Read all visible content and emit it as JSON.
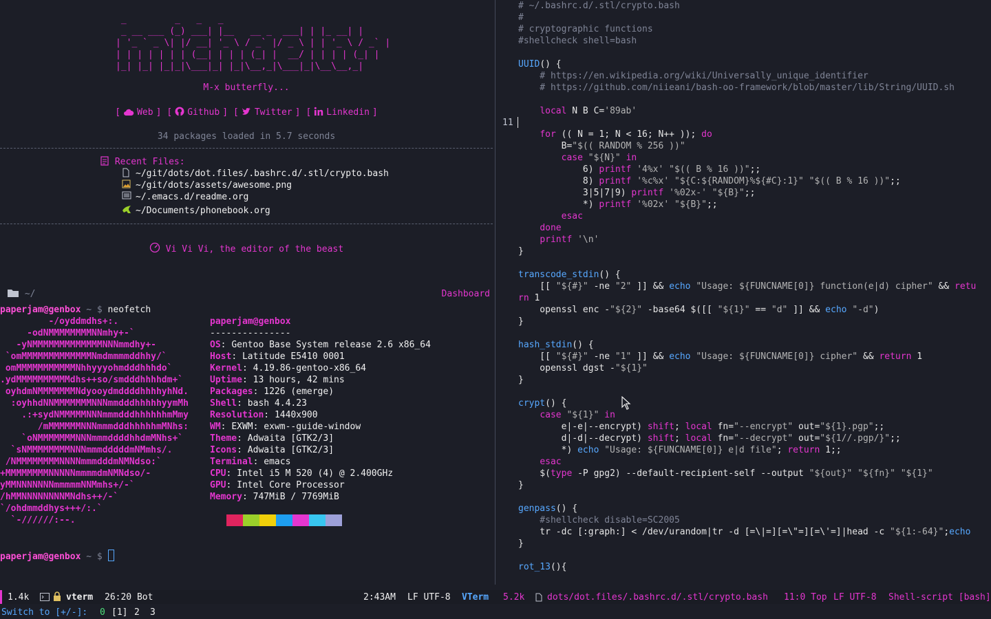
{
  "dashboard": {
    "banner": " _         _   _   _\n _ __ ___ (_) ___| |__   __ _  ___| | |_ __| |\n| '_ ` _ \\| |/ __| '_ \\ / _` |/ _ \\ | | '_ \\ / _` |\n| | | | | | | (__| | | | (_| |  __/ | | | | (_| |\n|_| |_| |_|_|\\___|_| |_|\\__,_|\\___|_|\\__\\__,_|",
    "tagline": "M-x butterfly...",
    "links": [
      {
        "icon": "cloud-icon",
        "label": "Web"
      },
      {
        "icon": "github-icon",
        "label": "Github"
      },
      {
        "icon": "twitter-icon",
        "label": "Twitter"
      },
      {
        "icon": "linkedin-icon",
        "label": "Linkedin"
      }
    ],
    "packages_line": "34 packages loaded in 5.7 seconds",
    "recent_header": "Recent Files:",
    "recent_files": [
      {
        "icon": "file-icon",
        "path": "~/git/dots/dot.files/.bashrc.d/.stl/crypto.bash"
      },
      {
        "icon": "image-icon",
        "path": "~/git/dots/assets/awesome.png"
      },
      {
        "icon": "org-file-icon",
        "path": "~/.emacs.d/readme.org"
      },
      {
        "icon": "org-unicorn-icon",
        "path": "~/Documents/phonebook.org"
      }
    ],
    "footer_text": "Vi Vi Vi, the editor of the beast",
    "folder_path": "~/",
    "buffer_label": "Dashboard"
  },
  "terminal": {
    "prompt1_user": "paperjam@genbox",
    "prompt1_path": "~ $",
    "prompt1_cmd": " neofetch",
    "art_lines": [
      "         -/oyddmdhs+:.",
      "     -odNMMMMMMMMNNmhy+-`",
      "   -yNMMMMMMMMMMMMMNNNmmdhy+-",
      " `omMMMMMMMMMMMMMNmdmmmmddhhy/`",
      " omMMMMMMMMMMMNhhyyyohmdddhhhdo`",
      ".ydMMMMMMMMMMdhs++so/smdddhhhhdm+`",
      " oyhdmNMMMMMMMNdyooydmddddhhhhyhNd.",
      "  :oyhhdNNMMMMMMMNNNmmdddhhhhhyymMh",
      "    .:+sydNMMMMMNNNmmmdddhhhhhhmMmy",
      "       /mMMMMMMNNNmmmdddhhhhhmMNhs:",
      "    `oNMMMMMMMNNNmmmddddhhdmMNhs+`",
      "  `sNMMMMMMMMNNNmmmdddddmNMmhs/.",
      " /NMMMMMMMMNNNNmmmdddmNMNdso:`",
      "+MMMMMMMMNNNNNmmmmdmNMNdso/-",
      "yMMNNNNNNNmmmmmNNMmhs+/-`",
      "/hMMNNNNNNNNMNdhs++/-`",
      "`/ohdmmddhys+++/:.`",
      "  `-//////:--."
    ],
    "info_user": "paperjam@genbox",
    "info_sep": "---------------",
    "info": [
      {
        "k": "OS",
        "v": "Gentoo Base System release 2.6 x86_64"
      },
      {
        "k": "Host",
        "v": "Latitude E5410 0001"
      },
      {
        "k": "Kernel",
        "v": "4.19.86-gentoo-x86_64"
      },
      {
        "k": "Uptime",
        "v": "13 hours, 42 mins"
      },
      {
        "k": "Packages",
        "v": "1226 (emerge)"
      },
      {
        "k": "Shell",
        "v": "bash 4.4.23"
      },
      {
        "k": "Resolution",
        "v": "1440x900"
      },
      {
        "k": "WM",
        "v": "EXWM: exwm--guide-window"
      },
      {
        "k": "Theme",
        "v": "Adwaita [GTK2/3]"
      },
      {
        "k": "Icons",
        "v": "Adwaita [GTK2/3]"
      },
      {
        "k": "Terminal",
        "v": "emacs"
      },
      {
        "k": "CPU",
        "v": "Intel i5 M 520 (4) @ 2.400GHz"
      },
      {
        "k": "GPU",
        "v": "Intel Core Processor"
      },
      {
        "k": "Memory",
        "v": "747MiB / 7769MiB"
      }
    ],
    "swatch_colors": [
      "#1c1e27",
      "#e0245e",
      "#9bd02a",
      "#f0d00a",
      "#1e9ef0",
      "#e436cf",
      "#38c6f0",
      "#9da0d8"
    ],
    "prompt2_user": "paperjam@genbox",
    "prompt2_path": "~ $"
  },
  "editor": {
    "current_line_number": "11",
    "lines": [
      [
        [
          "c",
          "# ~/.bashrc.d/.stl/crypto.bash"
        ]
      ],
      [
        [
          "c",
          "#"
        ]
      ],
      [
        [
          "c",
          "# cryptographic functions"
        ]
      ],
      [
        [
          "c",
          "#shellcheck shell=bash"
        ]
      ],
      [],
      [
        [
          "fn",
          "UUID"
        ],
        [
          "v",
          "() {"
        ]
      ],
      [
        [
          "c",
          "    # https://en.wikipedia.org/wiki/Universally_unique_identifier"
        ]
      ],
      [
        [
          "c",
          "    # https://github.com/niieani/bash-oo-framework/blob/master/lib/String/UUID.sh"
        ]
      ],
      [],
      [
        [
          "v",
          "    "
        ],
        [
          "kw",
          "local"
        ],
        [
          "v",
          " N B C="
        ],
        [
          "str",
          "'89ab'"
        ]
      ],
      [],
      [
        [
          "v",
          "    "
        ],
        [
          "kw",
          "for"
        ],
        [
          "v",
          " (( N = 1; N < 16; N++ )); "
        ],
        [
          "kw",
          "do"
        ]
      ],
      [
        [
          "v",
          "        B="
        ],
        [
          "str",
          "\"$(( RANDOM % 256 ))\""
        ]
      ],
      [
        [
          "v",
          "        "
        ],
        [
          "kw",
          "case"
        ],
        [
          "v",
          " "
        ],
        [
          "str",
          "\"${N}\""
        ],
        [
          "v",
          " "
        ],
        [
          "kw",
          "in"
        ]
      ],
      [
        [
          "v",
          "            6) "
        ],
        [
          "kw",
          "printf"
        ],
        [
          "v",
          " "
        ],
        [
          "str",
          "'4%x'"
        ],
        [
          "v",
          " "
        ],
        [
          "str",
          "\"$(( B % 16 ))\""
        ],
        [
          "v",
          ";;"
        ]
      ],
      [
        [
          "v",
          "            8) "
        ],
        [
          "kw",
          "printf"
        ],
        [
          "v",
          " "
        ],
        [
          "str",
          "'%c%x'"
        ],
        [
          "v",
          " "
        ],
        [
          "str",
          "\"${C:${RANDOM}%${#C}:1}\""
        ],
        [
          "v",
          " "
        ],
        [
          "str",
          "\"$(( B % 16 ))\""
        ],
        [
          "v",
          ";;"
        ]
      ],
      [
        [
          "v",
          "            3|5|7|9) "
        ],
        [
          "kw",
          "printf"
        ],
        [
          "v",
          " "
        ],
        [
          "str",
          "'%02x-'"
        ],
        [
          "v",
          " "
        ],
        [
          "str",
          "\"${B}\""
        ],
        [
          "v",
          ";;"
        ]
      ],
      [
        [
          "v",
          "            *) "
        ],
        [
          "kw",
          "printf"
        ],
        [
          "v",
          " "
        ],
        [
          "str",
          "'%02x'"
        ],
        [
          "v",
          " "
        ],
        [
          "str",
          "\"${B}\""
        ],
        [
          "v",
          ";;"
        ]
      ],
      [
        [
          "v",
          "        "
        ],
        [
          "kw",
          "esac"
        ]
      ],
      [
        [
          "v",
          "    "
        ],
        [
          "kw",
          "done"
        ]
      ],
      [
        [
          "v",
          "    "
        ],
        [
          "kw",
          "printf"
        ],
        [
          "v",
          " "
        ],
        [
          "str",
          "'\\n'"
        ]
      ],
      [
        [
          "v",
          "}"
        ]
      ],
      [],
      [
        [
          "fn",
          "transcode_stdin"
        ],
        [
          "v",
          "() {"
        ]
      ],
      [
        [
          "v",
          "    [[ "
        ],
        [
          "str",
          "\"${#}\""
        ],
        [
          "v",
          " -ne "
        ],
        [
          "str",
          "\"2\""
        ],
        [
          "v",
          " ]] && "
        ],
        [
          "fn",
          "echo"
        ],
        [
          "v",
          " "
        ],
        [
          "str",
          "\"Usage: ${FUNCNAME[0]} function(e|d) cipher\""
        ],
        [
          "v",
          " && "
        ],
        [
          "kw",
          "retu"
        ]
      ],
      [
        [
          "kw",
          "rn"
        ],
        [
          "v",
          " 1"
        ]
      ],
      [
        [
          "v",
          "    openssl enc -"
        ],
        [
          "str",
          "\"${2}\""
        ],
        [
          "v",
          " -base64 $([[ "
        ],
        [
          "str",
          "\"${1}\""
        ],
        [
          "v",
          " == "
        ],
        [
          "str",
          "\"d\""
        ],
        [
          "v",
          " ]] && "
        ],
        [
          "fn",
          "echo"
        ],
        [
          "v",
          " "
        ],
        [
          "str",
          "\"-d\""
        ],
        [
          "v",
          ")"
        ]
      ],
      [
        [
          "v",
          "}"
        ]
      ],
      [],
      [
        [
          "fn",
          "hash_stdin"
        ],
        [
          "v",
          "() {"
        ]
      ],
      [
        [
          "v",
          "    [[ "
        ],
        [
          "str",
          "\"${#}\""
        ],
        [
          "v",
          " -ne "
        ],
        [
          "str",
          "\"1\""
        ],
        [
          "v",
          " ]] && "
        ],
        [
          "fn",
          "echo"
        ],
        [
          "v",
          " "
        ],
        [
          "str",
          "\"Usage: ${FUNCNAME[0]} cipher\""
        ],
        [
          "v",
          " && "
        ],
        [
          "kw",
          "return"
        ],
        [
          "v",
          " 1"
        ]
      ],
      [
        [
          "v",
          "    openssl dgst -"
        ],
        [
          "str",
          "\"${1}\""
        ]
      ],
      [
        [
          "v",
          "}"
        ]
      ],
      [],
      [
        [
          "fn",
          "crypt"
        ],
        [
          "v",
          "() {"
        ]
      ],
      [
        [
          "v",
          "    "
        ],
        [
          "kw",
          "case"
        ],
        [
          "v",
          " "
        ],
        [
          "str",
          "\"${1}\""
        ],
        [
          "v",
          " "
        ],
        [
          "kw",
          "in"
        ]
      ],
      [
        [
          "v",
          "        e|-e|--encrypt) "
        ],
        [
          "kw",
          "shift"
        ],
        [
          "v",
          "; "
        ],
        [
          "kw",
          "local"
        ],
        [
          "v",
          " fn="
        ],
        [
          "str",
          "\"--encrypt\""
        ],
        [
          "v",
          " out="
        ],
        [
          "str",
          "\"${1}.pgp\""
        ],
        [
          "v",
          ";;"
        ]
      ],
      [
        [
          "v",
          "        d|-d|--decrypt) "
        ],
        [
          "kw",
          "shift"
        ],
        [
          "v",
          "; "
        ],
        [
          "kw",
          "local"
        ],
        [
          "v",
          " fn="
        ],
        [
          "str",
          "\"--decrypt\""
        ],
        [
          "v",
          " out="
        ],
        [
          "str",
          "\"${1//.pgp/}\""
        ],
        [
          "v",
          ";;"
        ]
      ],
      [
        [
          "v",
          "        *) "
        ],
        [
          "fn",
          "echo"
        ],
        [
          "v",
          " "
        ],
        [
          "str",
          "\"Usage: ${FUNCNAME[0]} e|d file\""
        ],
        [
          "v",
          "; "
        ],
        [
          "kw",
          "return"
        ],
        [
          "v",
          " 1;;"
        ]
      ],
      [
        [
          "v",
          "    "
        ],
        [
          "kw",
          "esac"
        ]
      ],
      [
        [
          "v",
          "    $("
        ],
        [
          "kw",
          "type"
        ],
        [
          "v",
          " -P gpg2) --default-recipient-self --output "
        ],
        [
          "str",
          "\"${out}\""
        ],
        [
          "v",
          " "
        ],
        [
          "str",
          "\"${fn}\""
        ],
        [
          "v",
          " "
        ],
        [
          "str",
          "\"${1}\""
        ]
      ],
      [
        [
          "v",
          "}"
        ]
      ],
      [],
      [
        [
          "fn",
          "genpass"
        ],
        [
          "v",
          "() {"
        ]
      ],
      [
        [
          "c",
          "    #shellcheck disable=SC2005"
        ]
      ],
      [
        [
          "v",
          "    tr -dc [:graph:] < /dev/urandom|tr -d [=\\|=][=\\\"=][=\\'=]|head -c "
        ],
        [
          "str",
          "\"${1:-64}\""
        ],
        [
          "v",
          ";"
        ],
        [
          "fn",
          "echo"
        ]
      ],
      [
        [
          "v",
          "}"
        ]
      ],
      [],
      [
        [
          "fn",
          "rot_13"
        ],
        [
          "v",
          "(){"
        ]
      ]
    ]
  },
  "modeline": {
    "left_size": "1.4k",
    "left_buffer": "vterm",
    "left_pos": "26:20 Bot",
    "time": "2:43AM",
    "left_enc": "LF UTF-8",
    "left_mode": "VTerm",
    "right_size": "5.2k",
    "right_file": "dots/dot.files/.bashrc.d/.stl/crypto.bash",
    "right_pos": "11:0 Top",
    "right_enc": "LF UTF-8",
    "right_mode": "Shell-script [bash]"
  },
  "minibuffer": {
    "switch_label": "Switch to [+/-]:",
    "workspaces": [
      "0",
      "[1]",
      "2",
      "3"
    ]
  }
}
